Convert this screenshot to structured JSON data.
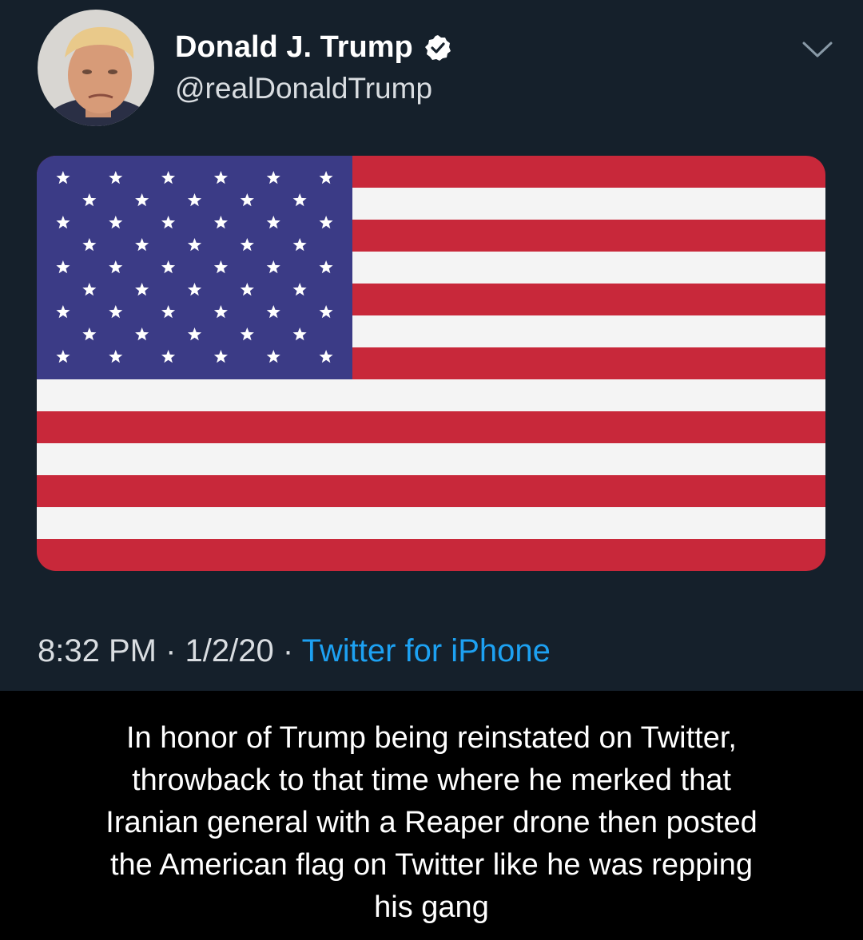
{
  "tweet": {
    "display_name": "Donald J. Trump",
    "handle": "@realDonaldTrump",
    "time": "8:32 PM",
    "separator": "·",
    "date": "1/2/20",
    "source": "Twitter for iPhone"
  },
  "flag": {
    "stripe_count": 13,
    "star_count": 50,
    "colors": {
      "red": "#c8283a",
      "white": "#f4f4f4",
      "canton": "#3b3b86",
      "star": "#ffffff"
    }
  },
  "colors": {
    "tweet_bg": "#15202b",
    "caption_bg": "#000000",
    "link": "#1da1f2",
    "verified": "#ffffff"
  },
  "icons": {
    "verified": "verified-badge-icon",
    "menu": "chevron-down-icon"
  },
  "caption": {
    "lines": [
      "In honor of Trump being reinstated on Twitter,",
      "throwback to that time where he merked that",
      "Iranian general with a Reaper drone then posted",
      "the American flag on Twitter like he was repping",
      "his gang"
    ]
  }
}
